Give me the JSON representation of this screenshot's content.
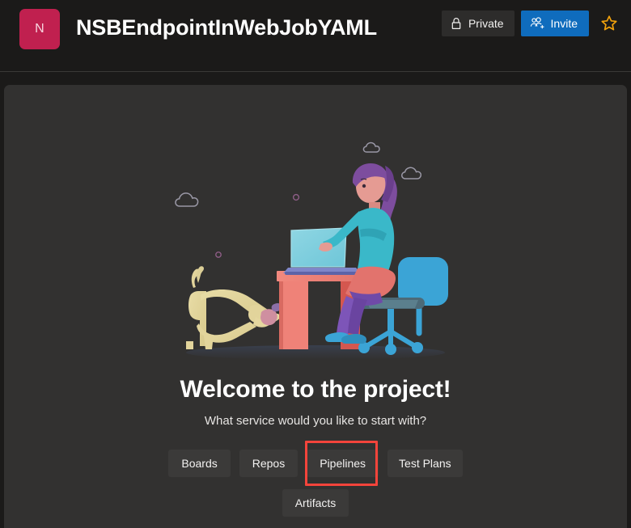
{
  "header": {
    "avatar_letter": "N",
    "avatar_color": "#c0204f",
    "project_title": "NSBEndpointInWebJobYAML",
    "private_label": "Private",
    "private_icon": "lock-icon",
    "invite_label": "Invite",
    "invite_icon": "add-people-icon",
    "invite_color": "#0f6cbd",
    "favorite_icon": "star-outline-icon",
    "favorite_color": "#f2a20c"
  },
  "main": {
    "title": "Welcome to the project!",
    "subtitle": "What service would you like to start with?",
    "illustration_alt": "woman-at-desk-with-laptop-and-dog-illustration",
    "services_row1": [
      {
        "label": "Boards",
        "name": "boards"
      },
      {
        "label": "Repos",
        "name": "repos"
      },
      {
        "label": "Pipelines",
        "name": "pipelines"
      },
      {
        "label": "Test Plans",
        "name": "test-plans"
      }
    ],
    "services_row2": [
      {
        "label": "Artifacts",
        "name": "artifacts"
      }
    ],
    "highlight": {
      "target": "Pipelines",
      "color": "#f4443b"
    }
  },
  "colors": {
    "header_bg": "#1b1a19",
    "panel_bg": "#323130",
    "button_bg": "#3b3a39",
    "accent_blue": "#0f6cbd",
    "accent_red": "#f4443b",
    "avatar_pink": "#c0204f"
  }
}
